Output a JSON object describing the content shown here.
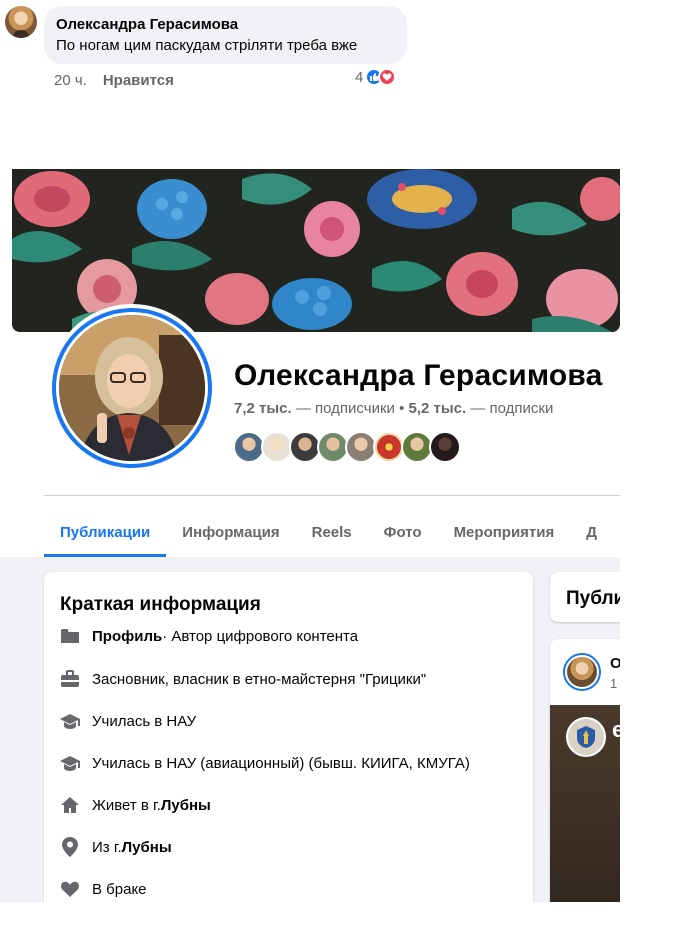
{
  "comment": {
    "author": "Олександра Герасимова",
    "text": "По ногам цим паскудам стріляти треба вже",
    "time": "20 ч.",
    "like_label": "Нравится",
    "reaction_count": "4",
    "reaction_icons": [
      "like-icon",
      "love-icon"
    ]
  },
  "profile": {
    "name": "Олександра Герасимова",
    "followers_count": "7,2 тыс.",
    "followers_label": "— подписчики",
    "separator": "•",
    "following_count": "5,2 тыс.",
    "following_label": "— подписки",
    "follower_avatar_count": 8
  },
  "tabs": [
    {
      "label": "Публикации",
      "active": true
    },
    {
      "label": "Информация",
      "active": false
    },
    {
      "label": "Reels",
      "active": false
    },
    {
      "label": "Фото",
      "active": false
    },
    {
      "label": "Мероприятия",
      "active": false
    },
    {
      "label": "Д",
      "active": false
    }
  ],
  "intro": {
    "title": "Краткая информация",
    "items": [
      {
        "icon": "profile-category-icon",
        "bold_prefix": "Профиль",
        "text": " · Автор цифрового контента",
        "bold_suffix": ""
      },
      {
        "icon": "work-icon",
        "bold_prefix": "",
        "text": "Засновник, власник в етно-майстерня \"Грицики\"",
        "bold_suffix": ""
      },
      {
        "icon": "education-icon",
        "bold_prefix": "",
        "text": "Училась в НАУ",
        "bold_suffix": ""
      },
      {
        "icon": "education-icon",
        "bold_prefix": "",
        "text": "Училась в НАУ (авиационный) (бывш. КИИГА, КМУГА)",
        "bold_suffix": ""
      },
      {
        "icon": "home-icon",
        "bold_prefix": "",
        "text": "Живет в г. ",
        "bold_suffix": "Лубны"
      },
      {
        "icon": "location-pin-icon",
        "bold_prefix": "",
        "text": "Из г. ",
        "bold_suffix": "Лубны"
      },
      {
        "icon": "heart-icon",
        "bold_prefix": "",
        "text": "В браке",
        "bold_suffix": ""
      }
    ]
  },
  "posts": {
    "title": "Публикации",
    "post_author": "О",
    "post_time": "1",
    "post_image_text": "е"
  },
  "colors": {
    "accent": "#1877f2",
    "secondary_text": "#65676b",
    "panel_background": "#f0f2f5",
    "love": "#f33e58"
  }
}
